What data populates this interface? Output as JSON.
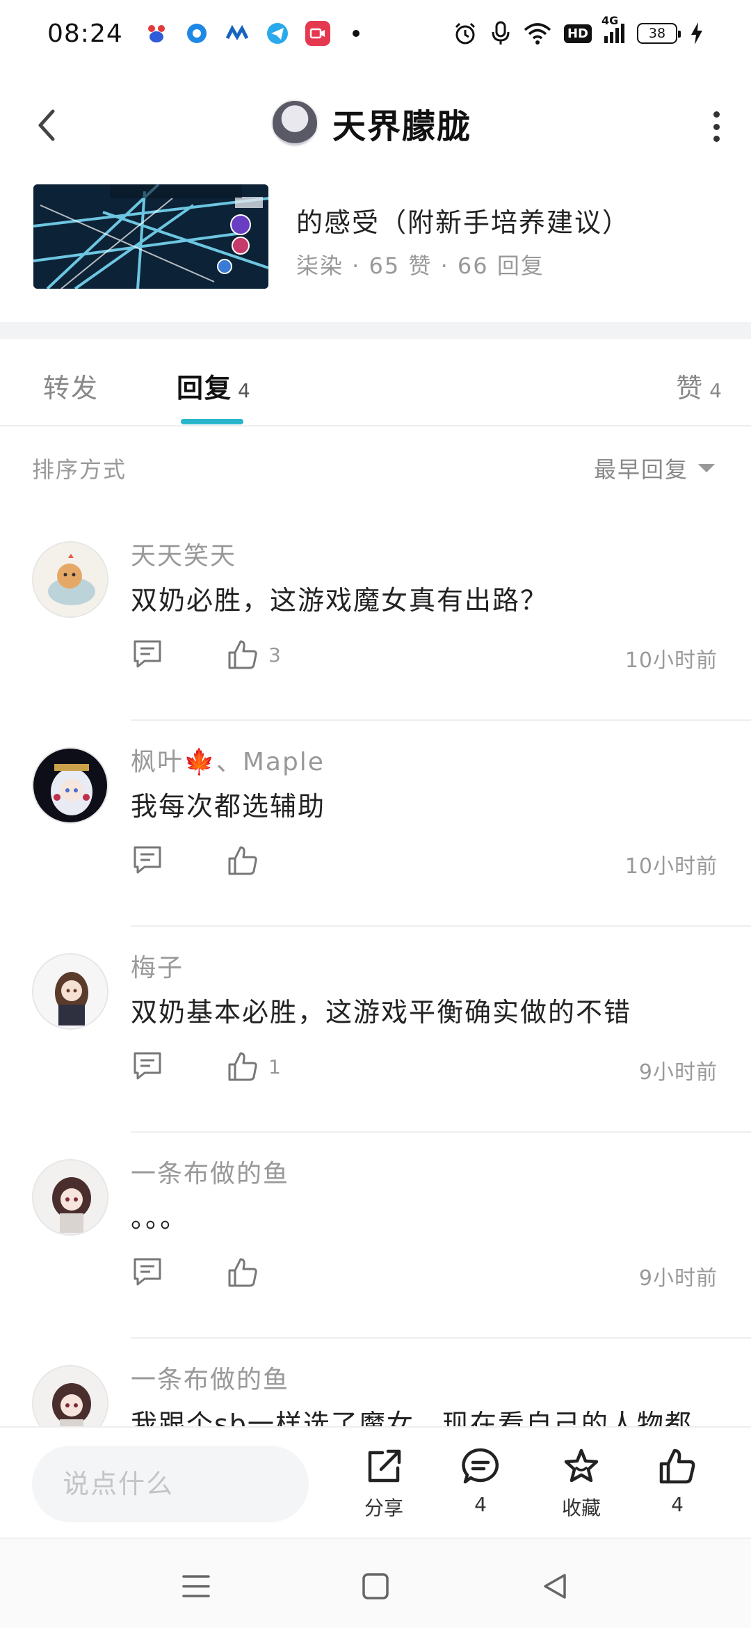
{
  "status_bar": {
    "time": "08:24",
    "network": "4G",
    "hd": "HD",
    "battery": "38"
  },
  "header": {
    "title": "天界朦胧"
  },
  "post": {
    "title": "的感受（附新手培养建议）",
    "meta": "柒染 · 65 赞 · 66 回复"
  },
  "tabs": [
    {
      "label": "转发",
      "count": ""
    },
    {
      "label": "回复",
      "count": "4"
    },
    {
      "label": "赞",
      "count": "4"
    }
  ],
  "sort": {
    "label": "排序方式",
    "selected": "最早回复"
  },
  "replies": [
    {
      "user": "天天笑天",
      "text": "双奶必胜，这游戏魔女真有出路？",
      "likes": "3",
      "time": "10小时前"
    },
    {
      "user": "枫叶🍁、Maple",
      "text": "我每次都选辅助",
      "likes": "",
      "time": "10小时前"
    },
    {
      "user": "梅子",
      "text": "双奶基本必胜，这游戏平衡确实做的不错",
      "likes": "1",
      "time": "9小时前"
    },
    {
      "user": "一条布做的鱼",
      "text": "。。。",
      "likes": "",
      "time": "9小时前"
    },
    {
      "user": "一条布做的鱼",
      "text": "我跟个sb一样选了魔女，现在看自己的人物都",
      "likes": "",
      "time": ""
    }
  ],
  "bottom_bar": {
    "input_placeholder": "说点什么",
    "share_label": "分享",
    "comment_count": "4",
    "favorite_label": "收藏",
    "like_count": "4"
  },
  "colors": {
    "accent": "#29b5c9",
    "muted_text": "#999999",
    "divider": "#eeeeee"
  }
}
